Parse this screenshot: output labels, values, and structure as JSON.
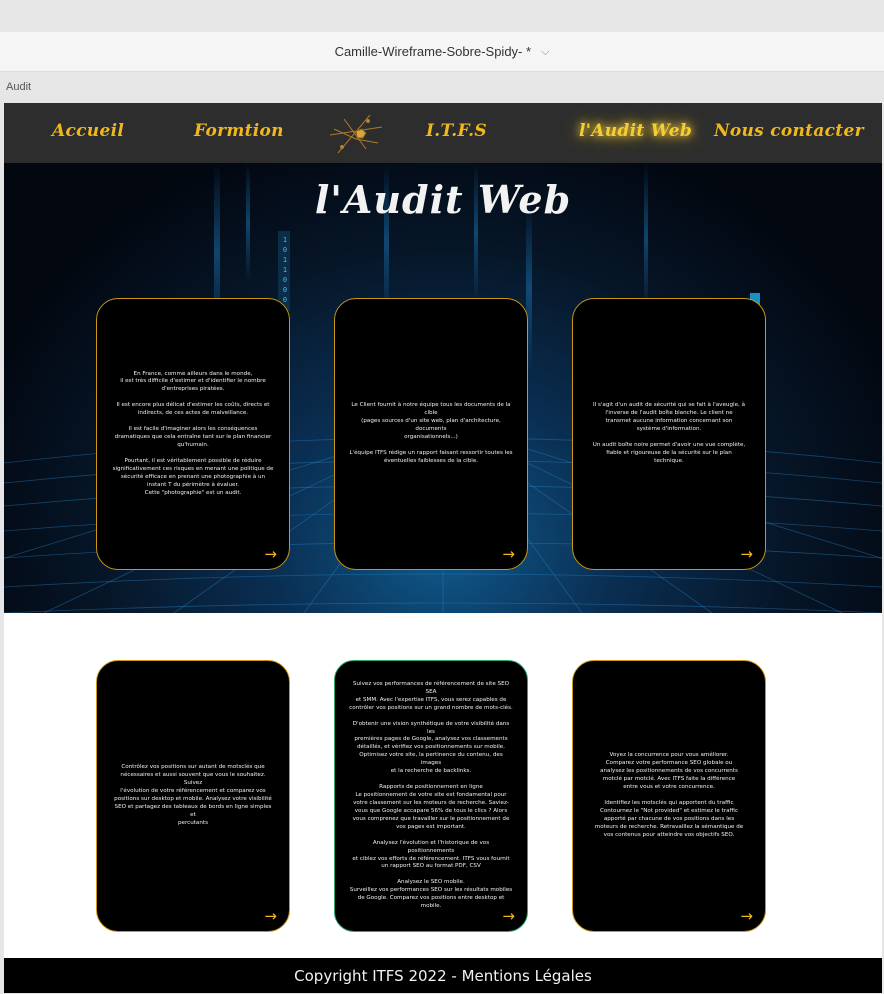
{
  "window": {
    "title": "Camille-Wireframe-Sobre-Spidy-",
    "modified_marker": "*",
    "dropdown_icon": "chevron-down-icon"
  },
  "page_label": "Audit",
  "nav": {
    "items": [
      {
        "label": "Accueil",
        "active": false
      },
      {
        "label": "Formtion",
        "active": false
      },
      {
        "label": "I.T.F.S",
        "active": false
      },
      {
        "label": "l'Audit Web",
        "active": true
      },
      {
        "label": "Nous contacter",
        "active": false
      }
    ],
    "accent": "#f0b81c"
  },
  "hero": {
    "title": "l'Audit Web",
    "binary_column": "1 0 1 1 0 0 0"
  },
  "cards_top": [
    {
      "text": "En France, comme ailleurs dans le monde,\nil est très difficile d'estimer et d'identifier le nombre\nd'entreprises piratées.\n\nIl est encore plus délicat d'estimer les coûts, directs et\nindirects, de ces actes de malveillance.\n\nIl est facile d'imaginer alors les conséquences\ndramatiques que cela entraîne tant sur le plan financier\nqu'humain.\n\nPourtant, il est véritablement possible de réduire\nsignificativement ces risques en menant une politique de\nsécurité efficace en prenant une photographie à un\ninstant T du périmètre à évaluer.\nCette \"photographie\" est un audit.",
      "arrow": "→"
    },
    {
      "text": "Le Client fournit à notre équipe tous les documents de la cible\n(pages sources d'un site web, plan d'architecture, documents\norganisationnels...)\n\nL'équipe ITFS rédige un rapport faisant ressortir toutes les\néventuelles faiblesses de la cible.",
      "arrow": "→"
    },
    {
      "text": "Il s'agit d'un audit de sécurité qui se fait à l'aveugle, à\nl'inverse de l'audit boîte blanche. Le client ne\ntransmet aucune information concernant son\nsystème d'information.\n\nUn audit boîte noire permet d'avoir une vue complète,\nfiable et rigoureuse de la sécurité sur le plan\ntechnique.",
      "arrow": "→"
    }
  ],
  "cards_bottom": [
    {
      "text": "Contrôlez vos positions sur autant de motsclés que\nnécessaires et aussi souvent que vous le souhaitez. Suivez\nl'évolution de votre référencement et comparez vos\npositions sur desktop et mobile. Analysez votre visibilité\nSEO et partagez des tableaux de bords en ligne simples et\npercutants",
      "arrow": "→"
    },
    {
      "text": "Suivez vos performances de référencement de site SEO SEA\net SMM. Avec l'expertise ITFS, vous serez capables de\ncontrôler vos positions sur un grand nombre de mots-clés.\n\nD'obtenir une vision synthétique de votre visibilité dans les\npremières pages de Google, analysez vos classements\ndétaillés, et vérifiez vos positionnements sur mobile.\nOptimisez votre site, la pertinence du contenu, des images\net la recherche de backlinks.\n\nRapports de positionnement en ligne\nLe positionnement de votre site est fondamental pour\nvotre classement sur les moteurs de recherche. Saviez-\nvous que Google accapare 56% de tous le clics ? Alors\nvous comprenez que travailler sur le positionnement de\nvos pages est important.\n\nAnalysez l'évolution et l'historique de vos positionnements\net ciblez vos efforts de référencement. ITFS vous fournit\nun rapport SEO au format PDF, CSV\n\nAnalysez le SEO mobile.\nSurveillez vos performances SEO sur les résultats mobiles\nde Google. Comparez vos positions entre desktop et\nmobile.",
      "arrow": "→"
    },
    {
      "text": "Voyez la concurrence pour vous améliorer.\nComparez votre performance SEO globale ou\nanalysez les positionnements de vos concurrents\nmotclé par motclé. Avec ITFS faite la différence\nentre vous et votre concurrence.\n\nIdentifiez les motsclés qui apportent du traffic\nContournez le \"Not provided\" et estimez le traffic\napporté par chacune de vos positions dans les\nmoteurs de recherche. Retravaillez la sémantique de\nvos contenus pour atteindre vos objectifs SEO.",
      "arrow": "→"
    }
  ],
  "footer": {
    "text": "Copyright ITFS 2022 - Mentions Légales"
  }
}
